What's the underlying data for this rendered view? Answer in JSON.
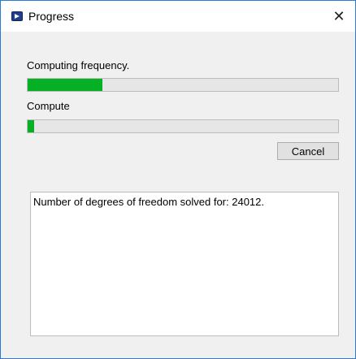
{
  "window": {
    "title": "Progress",
    "close_glyph": "✕"
  },
  "tasks": [
    {
      "label": "Computing frequency.",
      "progress_percent": 24
    },
    {
      "label": "Compute",
      "progress_percent": 2
    }
  ],
  "buttons": {
    "cancel_label": "Cancel"
  },
  "log": {
    "text": "Number of degrees of freedom solved for: 24012."
  },
  "colors": {
    "progress_fill": "#06b025",
    "window_border": "#2b79d7"
  },
  "icons": {
    "app": "app-icon",
    "close": "close-icon"
  }
}
